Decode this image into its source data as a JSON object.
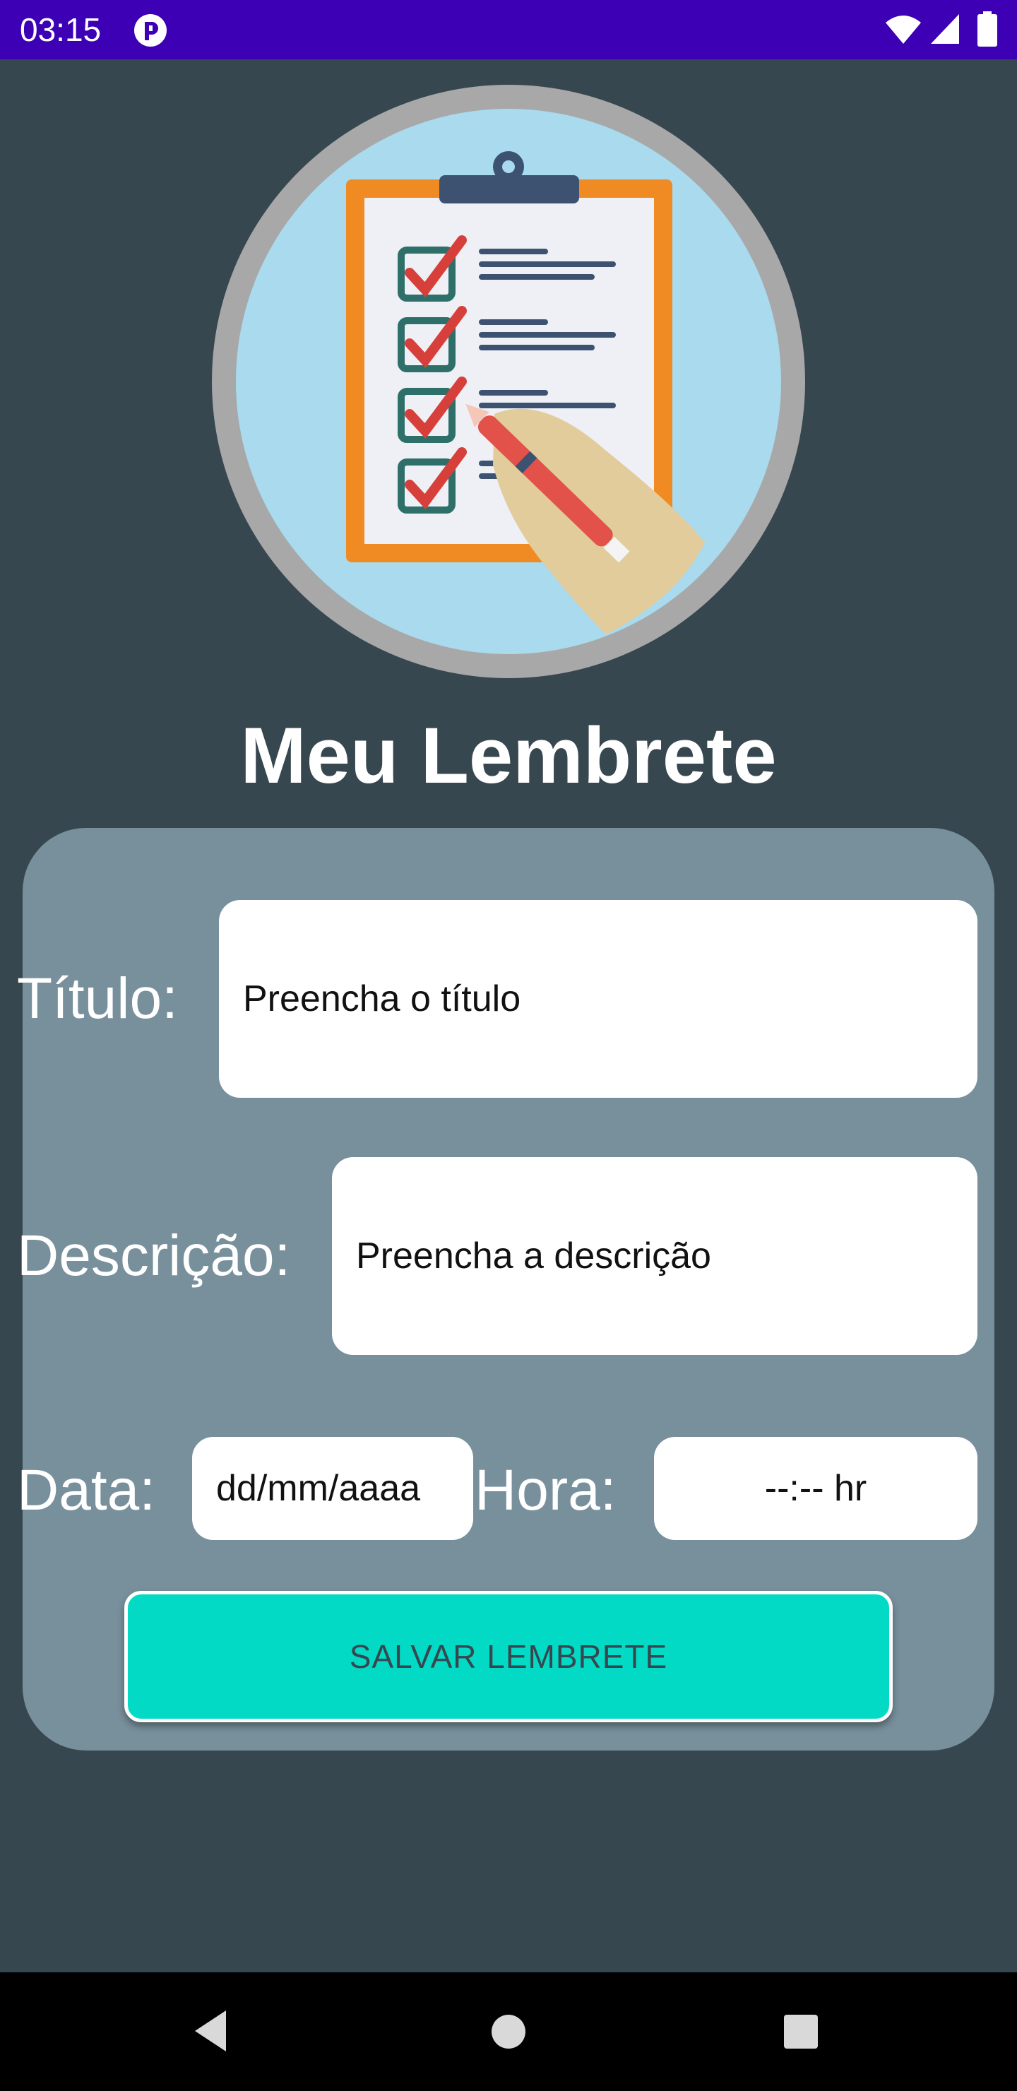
{
  "status_bar": {
    "time": "03:15",
    "icons": [
      "notification-icon",
      "wifi-icon",
      "signal-icon",
      "battery-icon"
    ],
    "color": "#3d00b5"
  },
  "hero": {
    "icon": "clipboard-checklist-illustration"
  },
  "app": {
    "title": "Meu Lembrete"
  },
  "form": {
    "title_label": "Título:",
    "title_placeholder": "Preencha o título",
    "description_label": "Descrição:",
    "description_placeholder": "Preencha a descrição",
    "date_label": "Data:",
    "date_placeholder": "dd/mm/aaaa",
    "hour_label": "Hora:",
    "hour_placeholder": "--:-- hr",
    "save_label": "SALVAR LEMBRETE"
  },
  "nav": {
    "icons": [
      "back-icon",
      "home-icon",
      "recents-icon"
    ]
  },
  "colors": {
    "background": "#37474f",
    "card": "#78909c",
    "accent": "#03dac5",
    "status_bar": "#3d00b5"
  }
}
